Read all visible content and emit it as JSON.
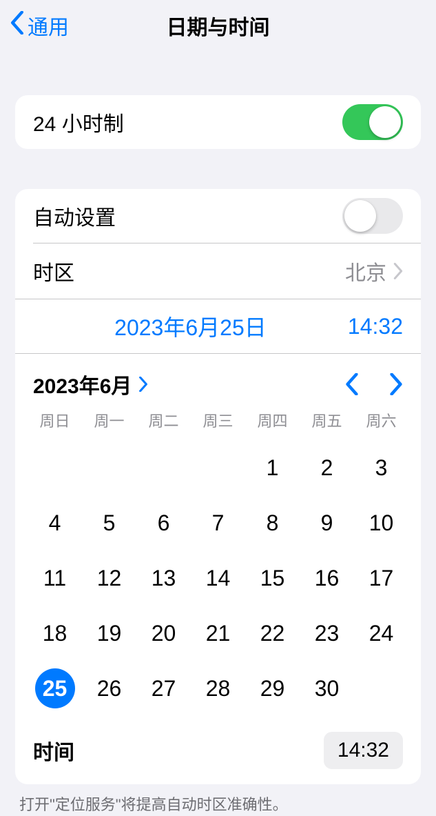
{
  "header": {
    "back_label": "通用",
    "title": "日期与时间"
  },
  "settings": {
    "time_format_24h_label": "24 小时制",
    "auto_set_label": "自动设置",
    "timezone_label": "时区",
    "timezone_value": "北京"
  },
  "selected": {
    "date": "2023年6月25日",
    "time": "14:32"
  },
  "calendar": {
    "month_label": "2023年6月",
    "weekdays": [
      "周日",
      "周一",
      "周二",
      "周三",
      "周四",
      "周五",
      "周六"
    ],
    "first_weekday_index": 4,
    "days_in_month": 30,
    "selected_day": 25
  },
  "time_row": {
    "label": "时间",
    "value": "14:32"
  },
  "footer": "打开\"定位服务\"将提高自动时区准确性。"
}
